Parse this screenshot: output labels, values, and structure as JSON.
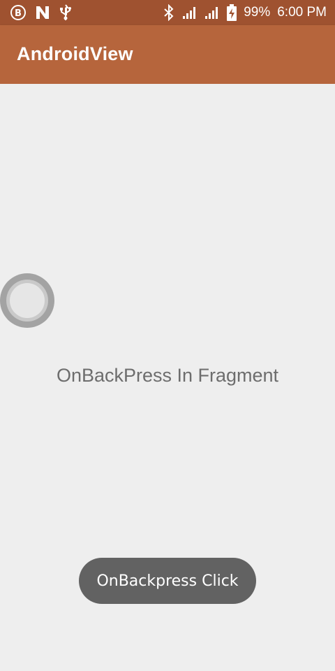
{
  "status_bar": {
    "battery_percent": "99%",
    "time": "6:00 PM",
    "icons": [
      "b-circle-icon",
      "n-icon",
      "usb-icon",
      "bluetooth-icon",
      "signal-icon",
      "signal-icon",
      "battery-charging-icon"
    ]
  },
  "app_bar": {
    "title": "AndroidView"
  },
  "main": {
    "text": "OnBackPress In Fragment"
  },
  "toast": {
    "message": "OnBackpress Click"
  },
  "colors": {
    "status_bar": "#9f5230",
    "app_bar": "#b6653c",
    "background": "#eeeeee",
    "toast": "#626262"
  }
}
